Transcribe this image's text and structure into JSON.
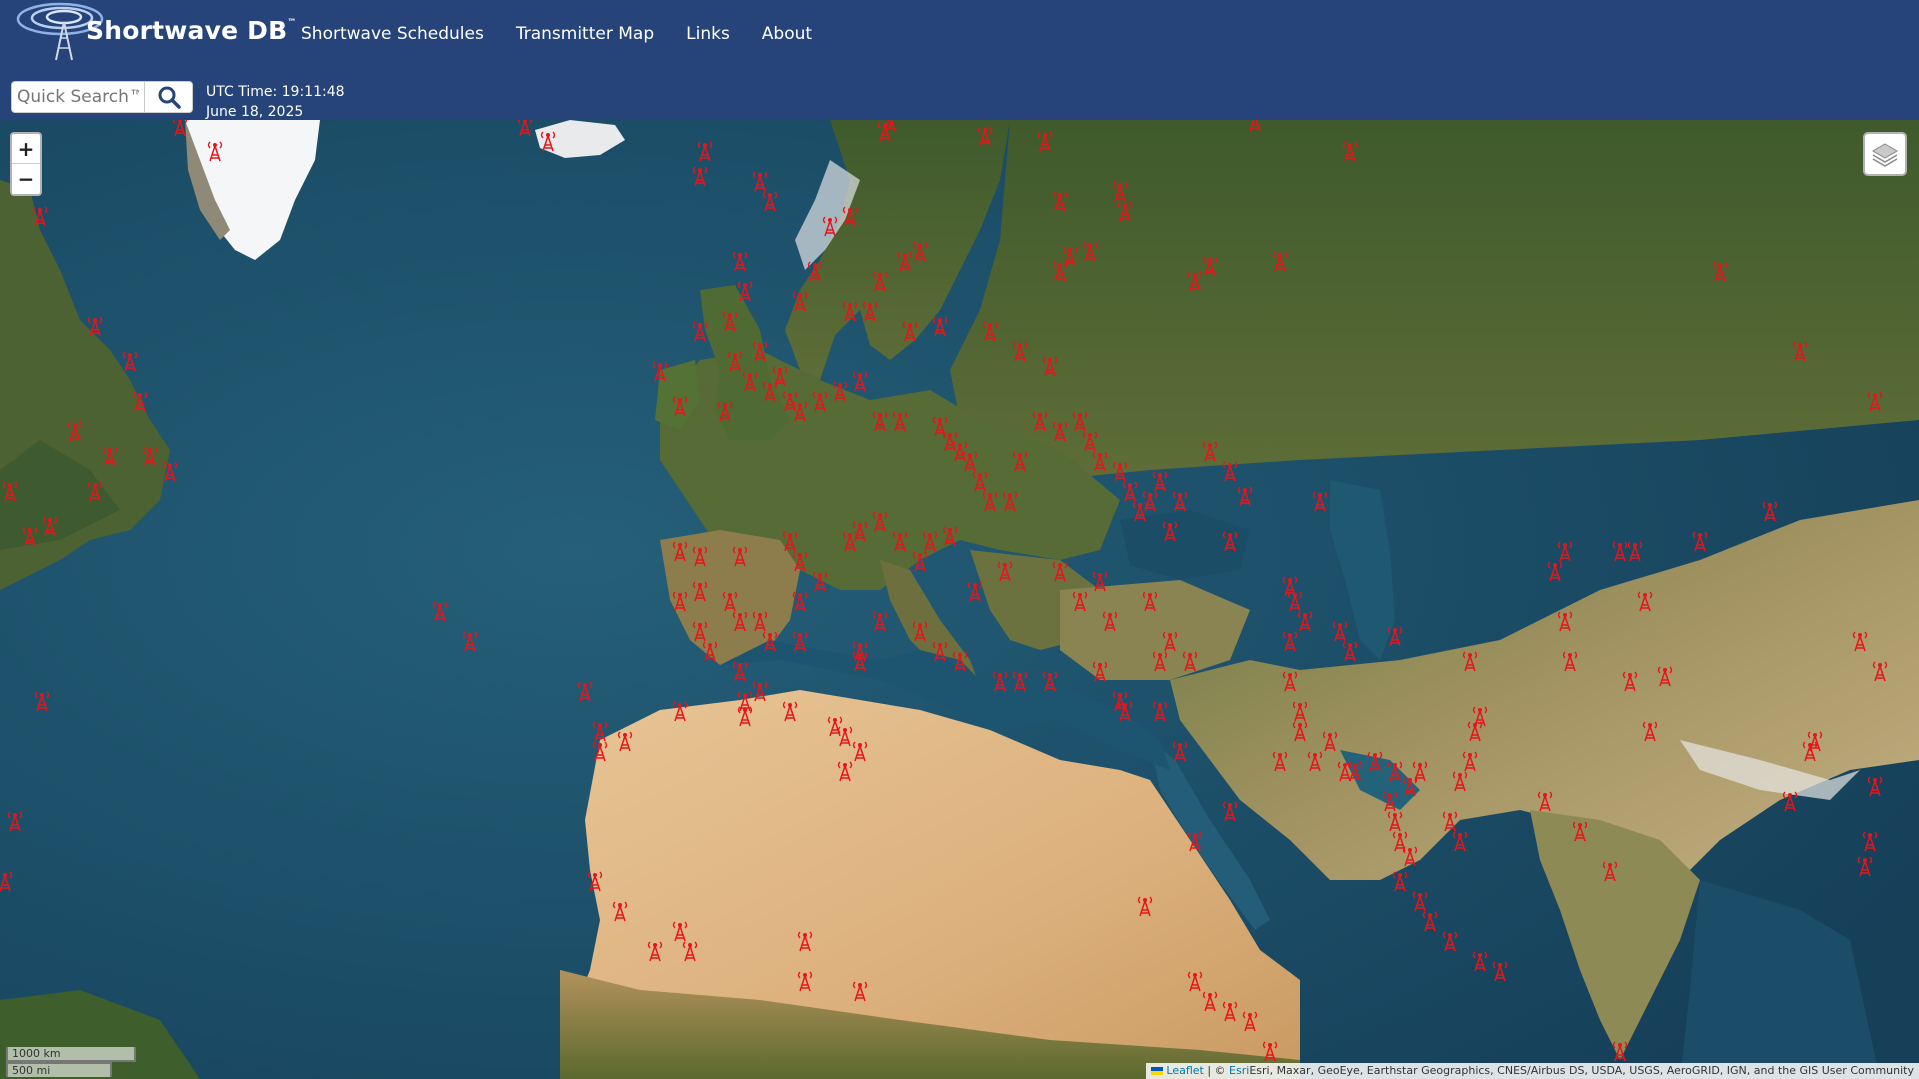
{
  "brand": {
    "name": "Shortwave DB",
    "tm": "™"
  },
  "nav": [
    {
      "label": "Shortwave Schedules"
    },
    {
      "label": "Transmitter Map"
    },
    {
      "label": "Links"
    },
    {
      "label": "About"
    }
  ],
  "search": {
    "placeholder": "Quick Search™",
    "icon": "search-icon"
  },
  "utc": {
    "time": "UTC Time: 19:11:48",
    "date": "June 18, 2025"
  },
  "map": {
    "zoom_in_label": "+",
    "zoom_out_label": "−",
    "layers_icon": "layers-icon",
    "marker_icon": "radio-tower-icon",
    "marker_color": "#e8141a",
    "scale_km": "1000 km",
    "scale_mi": "500 mi",
    "attribution": {
      "leaflet": "Leaflet",
      "separator": " | © ",
      "esri": "Esri",
      "sources": "Esri, Maxar, GeoEye, Earthstar Geographics, CNES/Airbus DS, USDA, USGS, AeroGRID, IGN, and the GIS User Community"
    }
  }
}
